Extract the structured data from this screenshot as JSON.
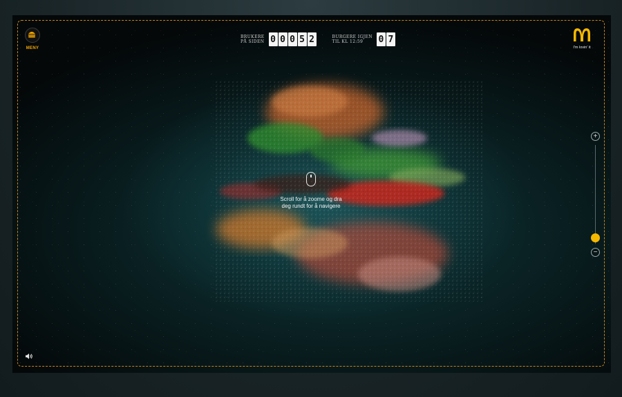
{
  "app": {
    "menu_label": "MENY",
    "brand_slogan": "I'm lovin' it",
    "brand_color": "#f5a800",
    "frame_color": "#c8871a"
  },
  "counters": {
    "users_label_line1": "BRUKERE",
    "users_label_line2": "PÅ SIDEN",
    "users_digits": [
      "0",
      "0",
      "0",
      "5",
      "2"
    ],
    "burgers_label_line1": "BURGERE IGJEN",
    "burgers_label_line2": "TIL KL 12:59",
    "burgers_digits": [
      "0",
      "7"
    ]
  },
  "hint": {
    "line1": "Scroll for å zoome og dra",
    "line2": "deg rundt for å navigere"
  },
  "zoom": {
    "plus_label": "+",
    "minus_label": "−",
    "level": 0.15
  },
  "icons": {
    "menu": "burger-menu-icon",
    "logo": "golden-arches-logo",
    "mouse": "mouse-icon",
    "sound": "speaker-icon"
  }
}
